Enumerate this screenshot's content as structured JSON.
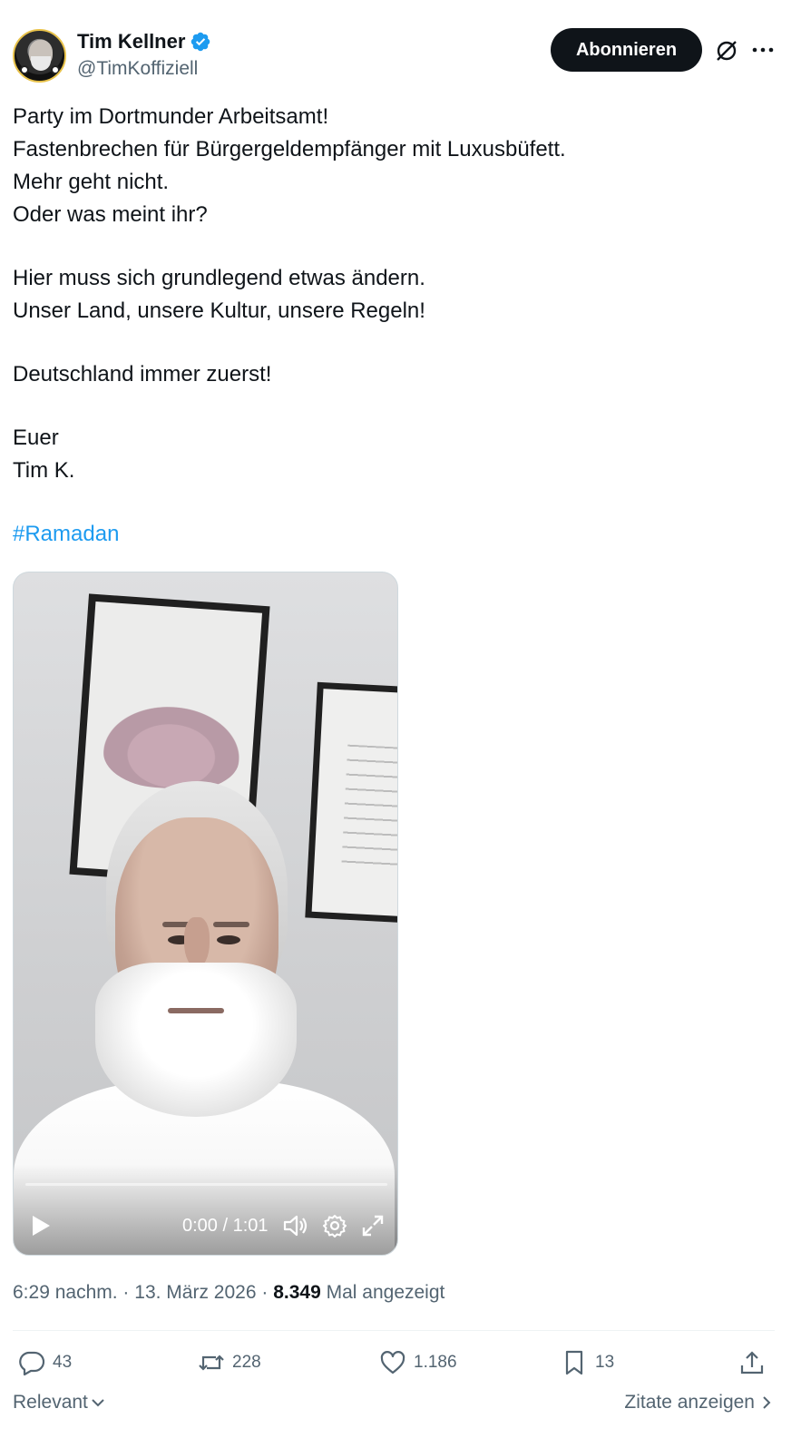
{
  "author": {
    "display_name": "Tim Kellner",
    "handle": "@TimKoffiziell",
    "verified_icon": "verified-badge-icon",
    "accent_color": "#1d9bf0"
  },
  "header": {
    "subscribe_label": "Abonnieren"
  },
  "post": {
    "paragraphs": [
      "Party im Dortmunder Arbeitsamt!\nFastenbrechen für Bürgergeldempfänger mit Luxusbüfett.\nMehr geht nicht.\nOder was meint ihr?",
      "Hier muss sich grundlegend etwas ändern.\nUnser Land, unsere Kultur, unsere Regeln!",
      "Deutschland immer zuerst!",
      "Euer\nTim K."
    ],
    "hashtag": "#Ramadan"
  },
  "video": {
    "time": "0:00 / 1:01",
    "progress": 0
  },
  "meta": {
    "time": "6:29 nachm.",
    "separator": "·",
    "date": "13. März 2026",
    "views_count": "8.349",
    "views_label": "Mal angezeigt"
  },
  "actions": {
    "replies": "43",
    "reposts": "228",
    "likes": "1.186",
    "bookmarks": "13"
  },
  "footer": {
    "sort_label": "Relevant",
    "quotes_label": "Zitate anzeigen"
  },
  "colors": {
    "text": "#0f1419",
    "secondary": "#536471",
    "button_bg": "#0f1419",
    "link": "#1d9bf0"
  }
}
